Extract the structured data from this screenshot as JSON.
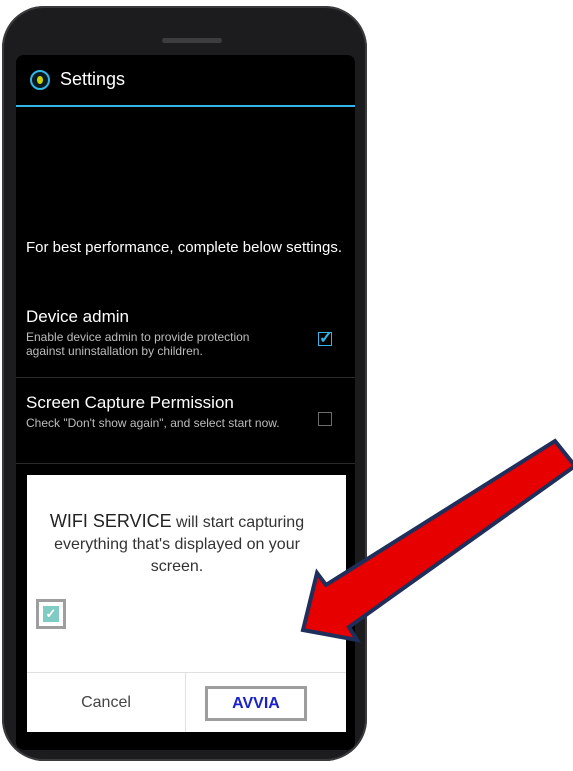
{
  "actionbar": {
    "title": "Settings",
    "icon": "app-shield-icon",
    "accent": "#33b5e5"
  },
  "intro": "For best performance, complete below settings.",
  "prefs": [
    {
      "title": "Device admin",
      "summary": "Enable device admin to provide protection against uninstallation by children.",
      "checked": true
    },
    {
      "title": "Screen Capture Permission",
      "summary": "Check \"Don't show again\", and select start now.",
      "checked": false
    }
  ],
  "dialog": {
    "app_name": "WIFI SERVICE",
    "message_rest": " will start capturing everything that's displayed on your screen.",
    "dont_show_checked": true,
    "cancel_label": "Cancel",
    "start_label": "AVVIA"
  },
  "annotation": {
    "arrow_color": "#e60000",
    "arrow_outline": "#1f2f5c",
    "button_text_color": "#1a22c8"
  }
}
